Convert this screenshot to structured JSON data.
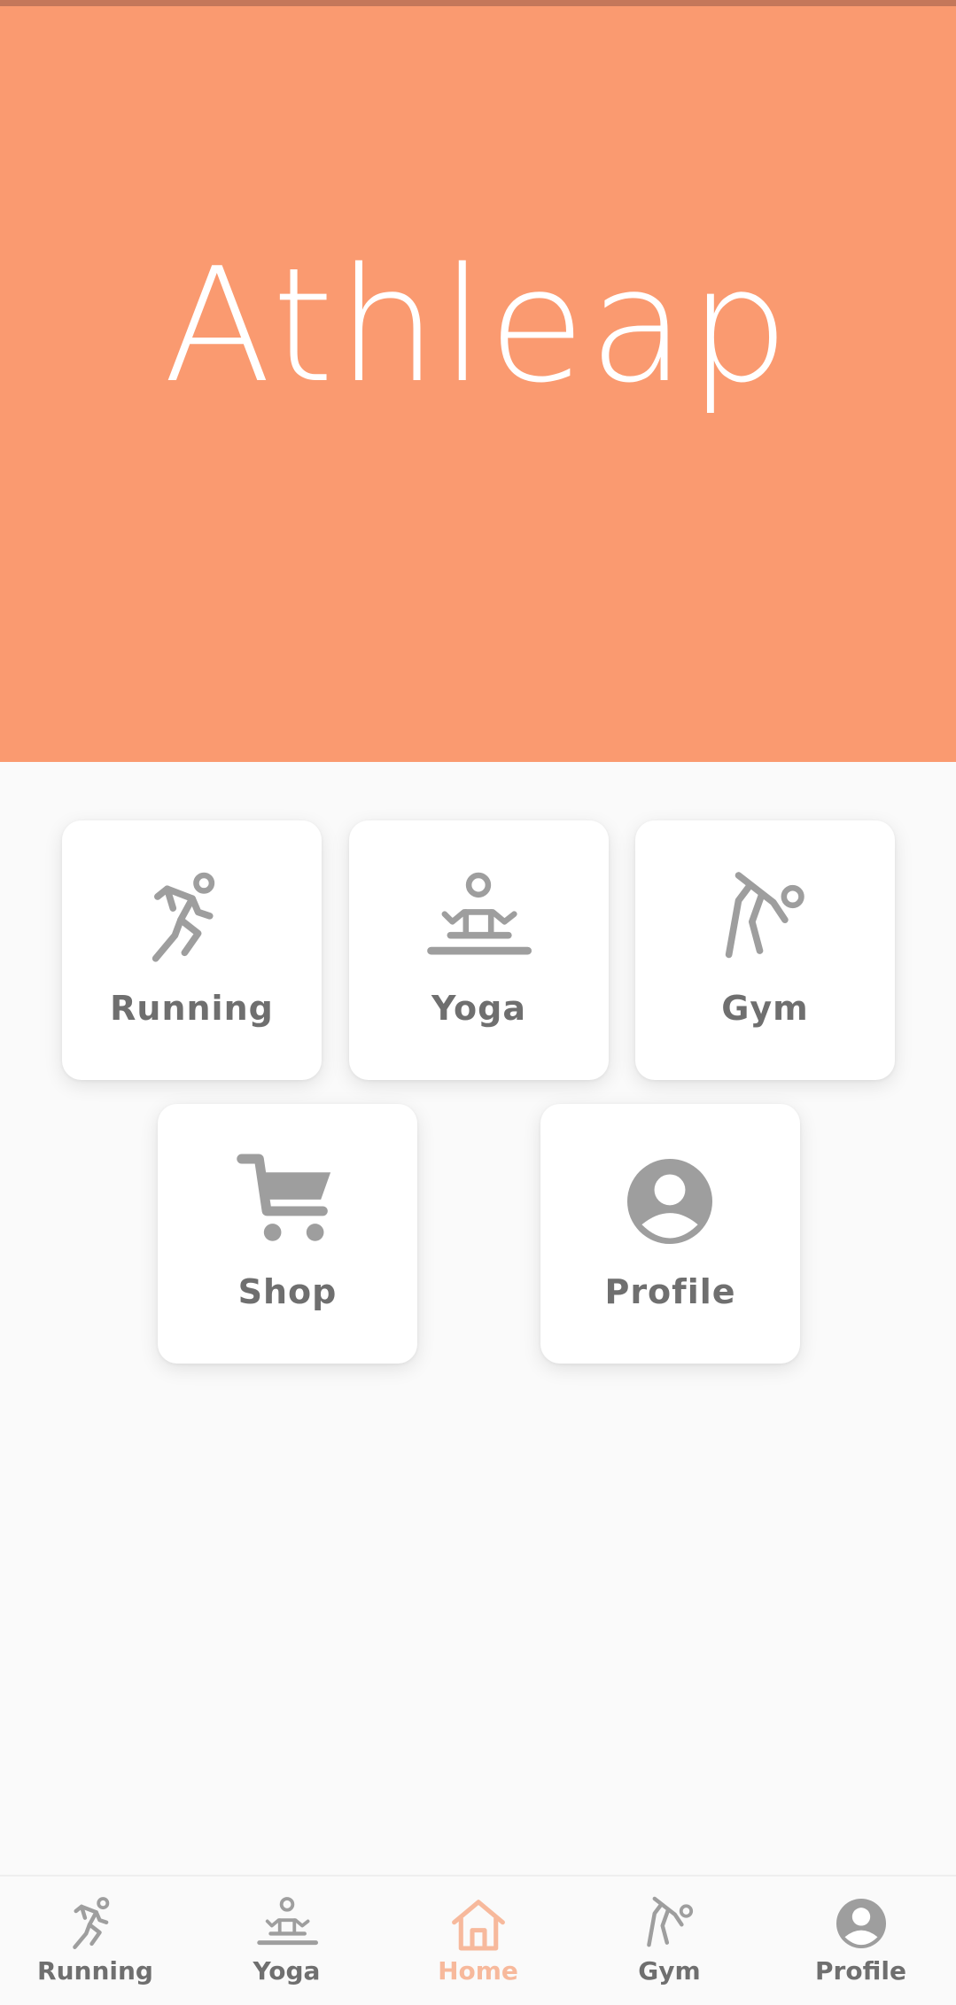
{
  "app": {
    "title": "Athleap"
  },
  "colors": {
    "brand": "#fa9a70",
    "icon": "#9e9e9e",
    "active": "#f7b99c",
    "label": "#6f6f6f"
  },
  "tiles": [
    {
      "label": "Running",
      "icon": "running-icon"
    },
    {
      "label": "Yoga",
      "icon": "yoga-icon"
    },
    {
      "label": "Gym",
      "icon": "gym-icon"
    },
    {
      "label": "Shop",
      "icon": "cart-icon"
    },
    {
      "label": "Profile",
      "icon": "account-icon"
    }
  ],
  "nav": {
    "active": "Home",
    "items": [
      {
        "label": "Running",
        "icon": "running-icon"
      },
      {
        "label": "Yoga",
        "icon": "yoga-icon"
      },
      {
        "label": "Home",
        "icon": "home-icon"
      },
      {
        "label": "Gym",
        "icon": "gym-icon"
      },
      {
        "label": "Profile",
        "icon": "account-icon"
      }
    ]
  }
}
